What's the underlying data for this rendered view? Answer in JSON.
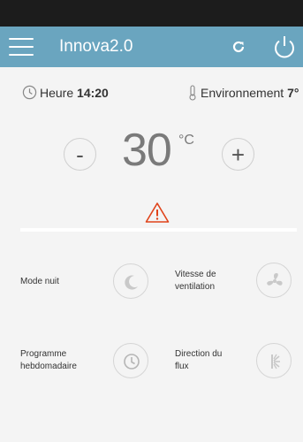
{
  "header": {
    "title": "Innova2.0"
  },
  "info": {
    "heure_label": "Heure",
    "heure_value": "14:20",
    "env_label": "Environnement",
    "env_value": "7°"
  },
  "thermostat": {
    "minus_label": "-",
    "plus_label": "+",
    "temperature": "30",
    "unit": "°C"
  },
  "features": {
    "mode_nuit": {
      "label": "Mode nuit"
    },
    "vitesse": {
      "line1": "Vitesse de",
      "line2": "ventilation"
    },
    "programme": {
      "line1": "Programme",
      "line2": "hebdomadaire"
    },
    "direction": {
      "line1": "Direction du",
      "line2": "flux"
    }
  },
  "colors": {
    "appbar": "#6aa5bf",
    "warning": "#e0431a",
    "statusbar": "#1c1c1c"
  },
  "icons": [
    "menu-icon",
    "refresh-icon",
    "power-icon",
    "clock-icon",
    "thermometer-icon",
    "warning-icon",
    "moon-icon",
    "fan-icon",
    "schedule-clock-icon",
    "airflow-icon"
  ]
}
